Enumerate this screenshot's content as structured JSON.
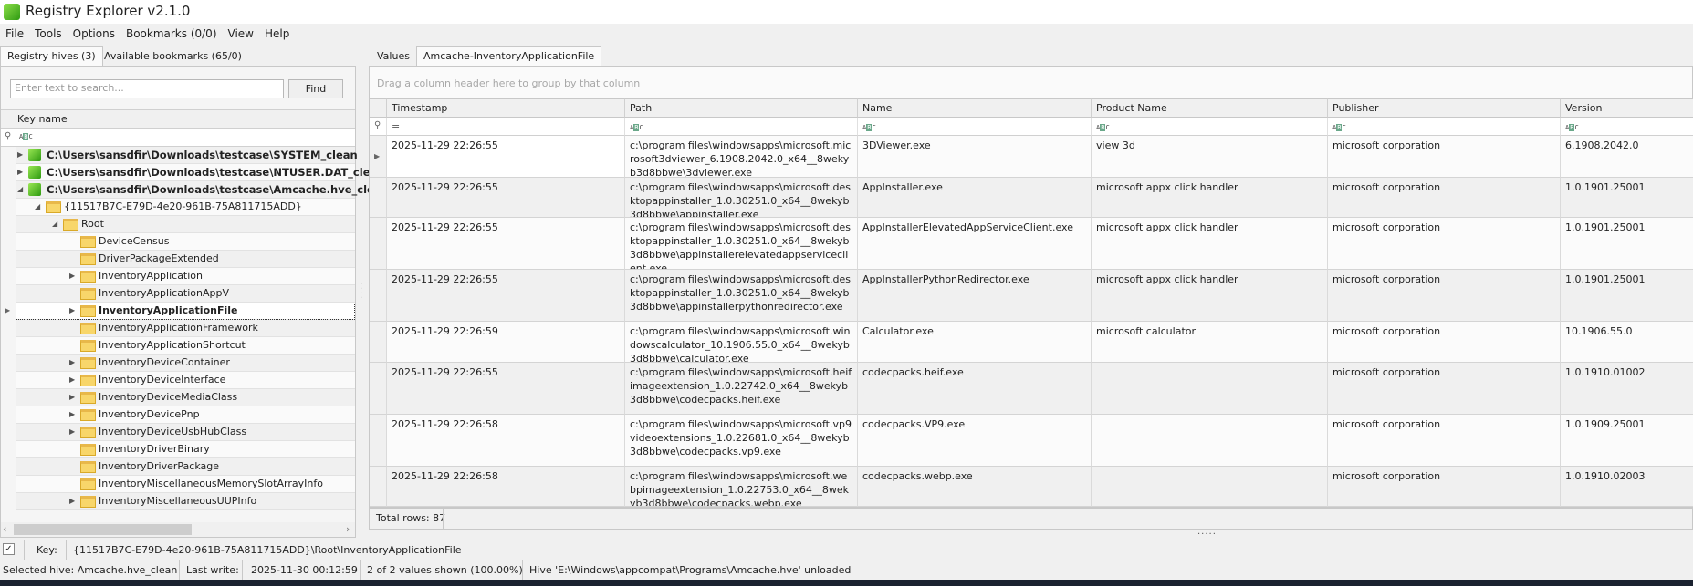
{
  "app": {
    "title": "Registry Explorer v2.1.0"
  },
  "menu": [
    "File",
    "Tools",
    "Options",
    "Bookmarks (0/0)",
    "View",
    "Help"
  ],
  "left_tabs": [
    {
      "label": "Registry hives (3)",
      "active": true
    },
    {
      "label": "Available bookmarks (65/0)",
      "active": false
    }
  ],
  "search": {
    "placeholder": "Enter text to search...",
    "find_label": "Find"
  },
  "tree": {
    "header": "Key name",
    "items": [
      {
        "label": "C:\\Users\\sansdfir\\Downloads\\testcase\\SYSTEM_clean",
        "level": 0,
        "type": "hive",
        "expander": "collapsed"
      },
      {
        "label": "C:\\Users\\sansdfir\\Downloads\\testcase\\NTUSER.DAT_clean",
        "level": 0,
        "type": "hive",
        "expander": "collapsed"
      },
      {
        "label": "C:\\Users\\sansdfir\\Downloads\\testcase\\Amcache.hve_clean",
        "level": 0,
        "type": "hive",
        "expander": "expanded"
      },
      {
        "label": "{11517B7C-E79D-4e20-961B-75A811715ADD}",
        "level": 1,
        "type": "folder",
        "expander": "expanded"
      },
      {
        "label": "Root",
        "level": 2,
        "type": "folder",
        "expander": "expanded"
      },
      {
        "label": "DeviceCensus",
        "level": 3,
        "type": "folder",
        "expander": "none"
      },
      {
        "label": "DriverPackageExtended",
        "level": 3,
        "type": "folder",
        "expander": "none"
      },
      {
        "label": "InventoryApplication",
        "level": 3,
        "type": "folder",
        "expander": "collapsed"
      },
      {
        "label": "InventoryApplicationAppV",
        "level": 3,
        "type": "folder",
        "expander": "none"
      },
      {
        "label": "InventoryApplicationFile",
        "level": 3,
        "type": "folder",
        "expander": "collapsed",
        "selected": true
      },
      {
        "label": "InventoryApplicationFramework",
        "level": 3,
        "type": "folder",
        "expander": "none"
      },
      {
        "label": "InventoryApplicationShortcut",
        "level": 3,
        "type": "folder",
        "expander": "none"
      },
      {
        "label": "InventoryDeviceContainer",
        "level": 3,
        "type": "folder",
        "expander": "collapsed"
      },
      {
        "label": "InventoryDeviceInterface",
        "level": 3,
        "type": "folder",
        "expander": "collapsed"
      },
      {
        "label": "InventoryDeviceMediaClass",
        "level": 3,
        "type": "folder",
        "expander": "collapsed"
      },
      {
        "label": "InventoryDevicePnp",
        "level": 3,
        "type": "folder",
        "expander": "collapsed"
      },
      {
        "label": "InventoryDeviceUsbHubClass",
        "level": 3,
        "type": "folder",
        "expander": "collapsed"
      },
      {
        "label": "InventoryDriverBinary",
        "level": 3,
        "type": "folder",
        "expander": "none"
      },
      {
        "label": "InventoryDriverPackage",
        "level": 3,
        "type": "folder",
        "expander": "none"
      },
      {
        "label": "InventoryMiscellaneousMemorySlotArrayInfo",
        "level": 3,
        "type": "folder",
        "expander": "none"
      },
      {
        "label": "InventoryMiscellaneousUUPInfo",
        "level": 3,
        "type": "folder",
        "expander": "collapsed"
      }
    ]
  },
  "right_tabs": [
    {
      "label": "Values",
      "active": false
    },
    {
      "label": "Amcache-InventoryApplicationFile",
      "active": true
    }
  ],
  "grid": {
    "group_hint": "Drag a column header here to group by that column",
    "columns": [
      "Timestamp",
      "Path",
      "Name",
      "Product Name",
      "Publisher",
      "Version"
    ],
    "timestamp_filter": "=",
    "rows": [
      [
        "2025-11-29 22:26:55",
        "c:\\program files\\windowsapps\\microsoft.microsoft3dviewer_6.1908.2042.0_x64__8wekyb3d8bbwe\\3dviewer.exe",
        "3DViewer.exe",
        "view 3d",
        "microsoft corporation",
        "6.1908.2042.0"
      ],
      [
        "2025-11-29 22:26:55",
        "c:\\program files\\windowsapps\\microsoft.desktopappinstaller_1.0.30251.0_x64__8wekyb3d8bbwe\\appinstaller.exe",
        "AppInstaller.exe",
        "microsoft appx click handler",
        "microsoft corporation",
        "1.0.1901.25001"
      ],
      [
        "2025-11-29 22:26:55",
        "c:\\program files\\windowsapps\\microsoft.desktopappinstaller_1.0.30251.0_x64__8wekyb3d8bbwe\\appinstallerelevatedappserviceclient.exe",
        "AppInstallerElevatedAppServiceClient.exe",
        "microsoft appx click handler",
        "microsoft corporation",
        "1.0.1901.25001"
      ],
      [
        "2025-11-29 22:26:55",
        "c:\\program files\\windowsapps\\microsoft.desktopappinstaller_1.0.30251.0_x64__8wekyb3d8bbwe\\appinstallerpythonredirector.exe",
        "AppInstallerPythonRedirector.exe",
        "microsoft appx click handler",
        "microsoft corporation",
        "1.0.1901.25001"
      ],
      [
        "2025-11-29 22:26:59",
        "c:\\program files\\windowsapps\\microsoft.windowscalculator_10.1906.55.0_x64__8wekyb3d8bbwe\\calculator.exe",
        "Calculator.exe",
        "microsoft calculator",
        "microsoft corporation",
        "10.1906.55.0"
      ],
      [
        "2025-11-29 22:26:55",
        "c:\\program files\\windowsapps\\microsoft.heifimageextension_1.0.22742.0_x64__8wekyb3d8bbwe\\codecpacks.heif.exe",
        "codecpacks.heif.exe",
        "",
        "microsoft corporation",
        "1.0.1910.01002"
      ],
      [
        "2025-11-29 22:26:58",
        "c:\\program files\\windowsapps\\microsoft.vp9videoextensions_1.0.22681.0_x64__8wekyb3d8bbwe\\codecpacks.vp9.exe",
        "codecpacks.VP9.exe",
        "",
        "microsoft corporation",
        "1.0.1909.25001"
      ],
      [
        "2025-11-29 22:26:58",
        "c:\\program files\\windowsapps\\microsoft.webpimageextension_1.0.22753.0_x64__8wekyb3d8bbwe\\codecpacks.webp.exe",
        "codecpacks.webp.exe",
        "",
        "microsoft corporation",
        "1.0.1910.02003"
      ]
    ],
    "total_rows": "Total rows: 87"
  },
  "keybar": {
    "label": "Key:",
    "value": "{11517B7C-E79D-4e20-961B-75A811715ADD}\\Root\\InventoryApplicationFile"
  },
  "status": {
    "selected_hive": "Selected hive: Amcache.hve_clean",
    "last_write_label": "Last write:",
    "last_write": "2025-11-30 00:12:59",
    "values_shown": "2 of 2 values shown (100.00%)",
    "message": "Hive 'E:\\Windows\\appcompat\\Programs\\Amcache.hve' unloaded"
  }
}
